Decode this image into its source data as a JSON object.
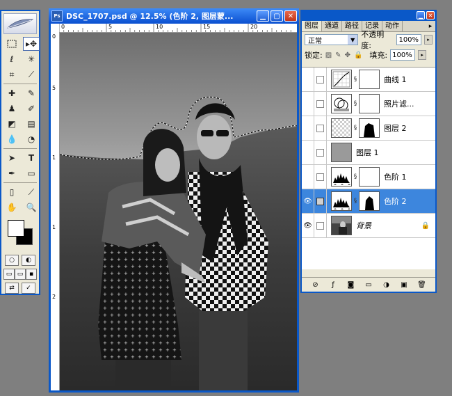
{
  "document": {
    "title": "DSC_1707.psd @ 12.5% (色阶 2, 图层蒙...",
    "ruler_top_ticks": [
      "0",
      "5",
      "10",
      "15",
      "20"
    ],
    "ruler_left_ticks": [
      "0",
      "5",
      "1",
      "1",
      "2"
    ]
  },
  "layers_panel": {
    "tabs": [
      "图层",
      "通道",
      "路径",
      "记录",
      "动作"
    ],
    "blend_mode": "正常",
    "opacity_label": "不透明度:",
    "opacity_value": "100%",
    "lock_label": "锁定:",
    "fill_label": "填充:",
    "fill_value": "100%",
    "layers": [
      {
        "name": "曲线 1",
        "type": "curves",
        "visible": false,
        "selected": false
      },
      {
        "name": "照片滤...",
        "type": "photo-filter",
        "visible": false,
        "selected": false
      },
      {
        "name": "图层 2",
        "type": "masked-pixel",
        "visible": false,
        "selected": false
      },
      {
        "name": "图层 1",
        "type": "gray-fill",
        "visible": false,
        "selected": false
      },
      {
        "name": "色阶 1",
        "type": "levels",
        "visible": false,
        "selected": false
      },
      {
        "name": "色阶 2",
        "type": "levels-masked",
        "visible": true,
        "selected": true
      },
      {
        "name": "背景",
        "type": "background",
        "visible": true,
        "selected": false,
        "locked": true
      }
    ]
  },
  "colors": {
    "window_frame": "#0a58c8",
    "panel_bg": "#ece9d8",
    "selection": "#3d86dd",
    "workspace": "#7f7f7f"
  }
}
